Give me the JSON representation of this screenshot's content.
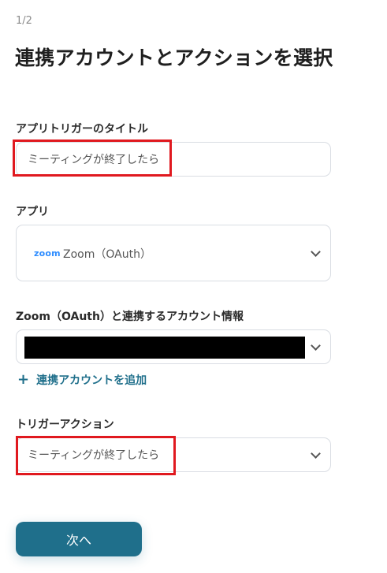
{
  "header": {
    "step": "1/2",
    "title": "連携アカウントとアクションを選択"
  },
  "trigger_title": {
    "label": "アプリトリガーのタイトル",
    "value": "ミーティングが終了したら"
  },
  "app": {
    "label": "アプリ",
    "logo_text": "zoom",
    "value": "Zoom（OAuth）"
  },
  "account": {
    "label": "Zoom（OAuth）と連携するアカウント情報",
    "value_masked": true,
    "add_link": "連携アカウントを追加"
  },
  "trigger_action": {
    "label": "トリガーアクション",
    "value": "ミーティングが終了したら"
  },
  "footer": {
    "next_label": "次へ"
  },
  "colors": {
    "accent": "#1f6f8b",
    "highlight": "#e0191f",
    "zoom_blue": "#2d8cff"
  }
}
